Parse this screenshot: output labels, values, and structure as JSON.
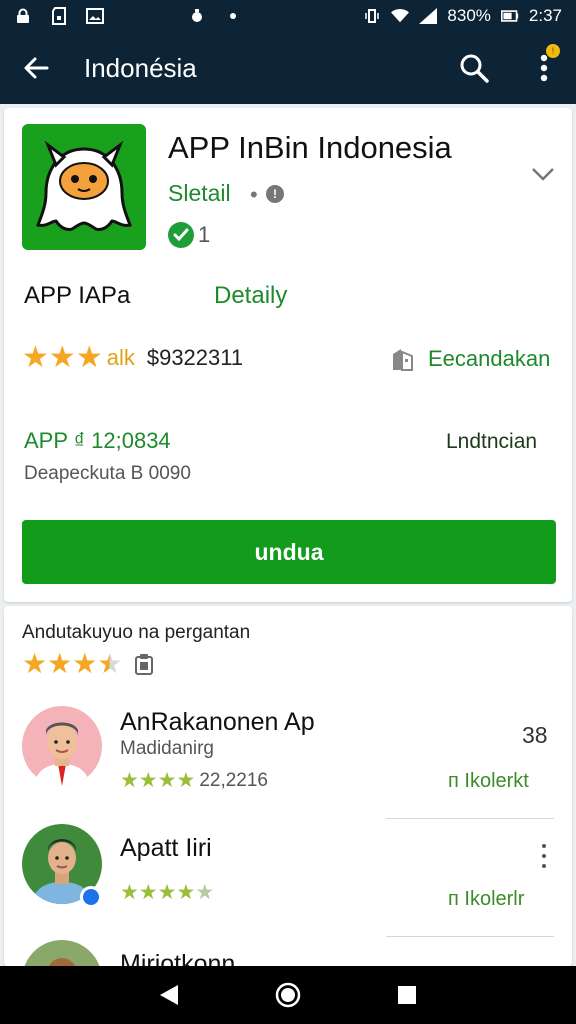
{
  "status_bar": {
    "battery_percent": "830%",
    "time": "2:37"
  },
  "app_bar": {
    "title": "Indonésia",
    "notification_badge": "!"
  },
  "app": {
    "name": "APP InBin Indonesia",
    "developer": "Sletail",
    "separator": "•",
    "info_glyph": "!",
    "verified_count": "1",
    "category": "APP IAPa",
    "detail_link": "Detaily",
    "rating_word": "alk",
    "rating_count": "$9322311",
    "recommendation": "Eecandakan",
    "size_label": "APP ₫ 12;0834",
    "downloads": "Deapeckuta B 0090",
    "language": "Lndtncian",
    "install_label": "undua"
  },
  "reviews": {
    "title": "Andutakuyuo na pergantan",
    "items": [
      {
        "name": "AnRakanonen Ap",
        "subtitle": "Madidanirg",
        "date": "22,2216",
        "count": "38",
        "helpful": "ᴨ Ikolerkt"
      },
      {
        "name": "Apatt Iiri",
        "helpful": "ᴨ Ikolerlr"
      },
      {
        "name": "Mirjotkonn"
      }
    ]
  },
  "colors": {
    "app_bar": "#0d2436",
    "accent_green": "#139c1b",
    "link_green": "#1e8a2c",
    "star_gold": "#f5a623"
  },
  "icons": [
    "lock-icon",
    "sd-card-icon",
    "image-icon",
    "alarm-icon",
    "wifi-icon",
    "signal-icon",
    "battery-icon",
    "back-arrow-icon",
    "search-icon",
    "more-vert-icon",
    "chevron-down-icon",
    "verified-check-icon",
    "building-icon",
    "clipboard-icon",
    "nav-back-icon",
    "nav-home-icon",
    "nav-recents-icon"
  ]
}
